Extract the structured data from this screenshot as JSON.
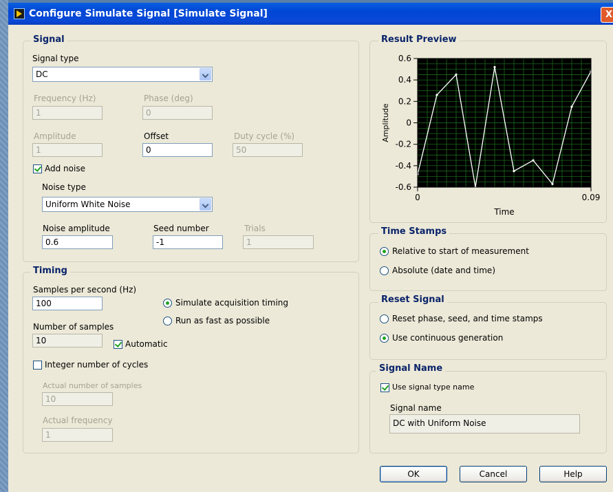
{
  "window": {
    "title": "Configure Simulate Signal [Simulate Signal]",
    "close_label": "X"
  },
  "signal": {
    "group_title": "Signal",
    "signal_type_label": "Signal type",
    "signal_type_value": "DC",
    "frequency_label": "Frequency (Hz)",
    "frequency_value": "1",
    "phase_label": "Phase (deg)",
    "phase_value": "0",
    "amplitude_label": "Amplitude",
    "amplitude_value": "1",
    "offset_label": "Offset",
    "offset_value": "0",
    "duty_label": "Duty cycle (%)",
    "duty_value": "50",
    "add_noise_label": "Add noise",
    "noise_type_label": "Noise type",
    "noise_type_value": "Uniform White Noise",
    "noise_amp_label": "Noise amplitude",
    "noise_amp_value": "0.6",
    "seed_label": "Seed number",
    "seed_value": "-1",
    "trials_label": "Trials",
    "trials_value": "1"
  },
  "timing": {
    "group_title": "Timing",
    "sps_label": "Samples per second (Hz)",
    "sps_value": "100",
    "sim_timing_label": "Simulate acquisition timing",
    "run_fast_label": "Run as fast as possible",
    "nsamples_label": "Number of samples",
    "nsamples_value": "10",
    "automatic_label": "Automatic",
    "integer_cycles_label": "Integer number of cycles",
    "actual_samples_label": "Actual number of samples",
    "actual_samples_value": "10",
    "actual_freq_label": "Actual frequency",
    "actual_freq_value": "1"
  },
  "preview": {
    "group_title": "Result Preview"
  },
  "timestamps": {
    "group_title": "Time Stamps",
    "relative_label": "Relative to start of measurement",
    "absolute_label": "Absolute (date and time)"
  },
  "reset": {
    "group_title": "Reset Signal",
    "reset_label": "Reset phase, seed, and time stamps",
    "continuous_label": "Use continuous generation"
  },
  "signal_name": {
    "group_title": "Signal Name",
    "use_type_label": "Use signal type name",
    "name_label": "Signal name",
    "name_value": "DC with Uniform Noise"
  },
  "buttons": {
    "ok": "OK",
    "cancel": "Cancel",
    "help": "Help"
  },
  "chart_data": {
    "type": "line",
    "title": "",
    "xlabel": "Time",
    "ylabel": "Amplitude",
    "xlim": [
      0,
      0.09
    ],
    "ylim": [
      -0.6,
      0.6
    ],
    "x_ticks": [
      "0",
      "0.09"
    ],
    "y_ticks": [
      "0.6",
      "0.4",
      "0.2",
      "0",
      "-0.2",
      "-0.4",
      "-0.6"
    ],
    "grid": true,
    "series": [
      {
        "x": [
          0,
          0.01,
          0.02,
          0.03,
          0.04,
          0.05,
          0.06,
          0.07,
          0.08,
          0.09
        ],
        "values": [
          -0.48,
          0.26,
          0.45,
          -0.6,
          0.52,
          -0.45,
          -0.35,
          -0.57,
          0.15,
          0.48
        ],
        "color": "#ffffff"
      }
    ],
    "background": "#000000",
    "grid_color": "#1f7a1f"
  }
}
